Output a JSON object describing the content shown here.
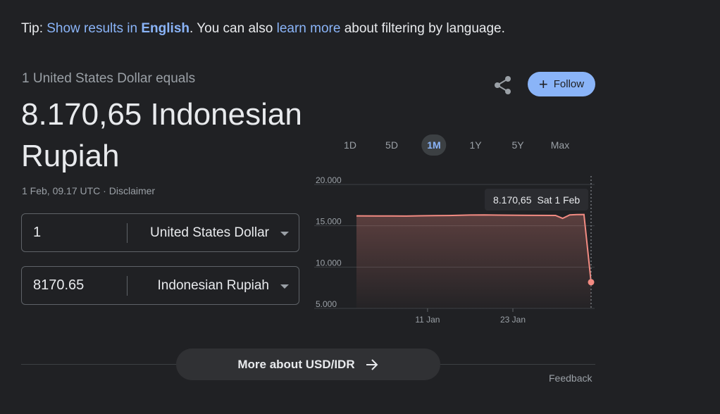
{
  "tip": {
    "prefix": "Tip: ",
    "show_results": "Show results in ",
    "language": "English",
    "middle": ". You can also ",
    "learn_more": "learn more",
    "suffix": " about filtering by language."
  },
  "converter": {
    "equals_label": "1 United States Dollar equals",
    "result_value": "8.170,65 Indonesian Rupiah",
    "timestamp": "1 Feb, 09.17 UTC",
    "separator": " · ",
    "disclaimer": "Disclaimer",
    "from": {
      "amount": "1",
      "currency": "United States Dollar"
    },
    "to": {
      "amount": "8170.65",
      "currency": "Indonesian Rupiah"
    }
  },
  "actions": {
    "share_icon": "share-icon",
    "follow_label": "Follow",
    "follow_icon": "+"
  },
  "range_tabs": [
    {
      "label": "1D",
      "active": false
    },
    {
      "label": "5D",
      "active": false
    },
    {
      "label": "1M",
      "active": true
    },
    {
      "label": "1Y",
      "active": false
    },
    {
      "label": "5Y",
      "active": false
    },
    {
      "label": "Max",
      "active": false
    }
  ],
  "tooltip": {
    "value": "8.170,65",
    "date": "Sat 1 Feb"
  },
  "chart_data": {
    "type": "area",
    "y_ticks": [
      "20.000",
      "15.000",
      "10.000",
      "5.000"
    ],
    "y_tick_values": [
      20000,
      15000,
      10000,
      5000
    ],
    "ylim": [
      5000,
      20000
    ],
    "x_tick_labels": [
      "11 Jan",
      "23 Jan"
    ],
    "x_tick_days": [
      10,
      22
    ],
    "x_range_days": [
      0,
      33
    ],
    "line_color": "#f28b82",
    "series": [
      {
        "days": [
          0,
          3,
          5,
          7,
          9,
          11,
          13,
          16,
          18,
          20,
          23,
          25,
          28,
          29,
          30,
          31,
          32,
          33
        ],
        "values": [
          16200,
          16180,
          16190,
          16170,
          16210,
          16230,
          16240,
          16300,
          16320,
          16290,
          16270,
          16260,
          16250,
          15900,
          16320,
          16350,
          16370,
          8170.65
        ]
      }
    ]
  },
  "footer": {
    "more_label": "More about USD/IDR",
    "more_icon": "arrow-right-icon",
    "feedback": "Feedback"
  }
}
